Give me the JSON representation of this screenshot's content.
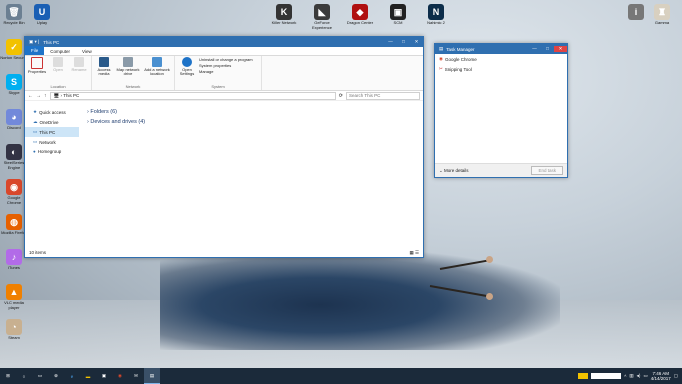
{
  "desktop": {
    "left_icons": [
      {
        "label": "Recycle Bin",
        "color": "#6b7f92",
        "glyph": "🗑"
      },
      {
        "label": "Norton Security",
        "color": "#f2c200",
        "glyph": "✓"
      },
      {
        "label": "Skype",
        "color": "#00aff0",
        "glyph": "S"
      },
      {
        "label": "Discord",
        "color": "#7289da",
        "glyph": "◕"
      },
      {
        "label": "SteelSeries Engine",
        "color": "#334",
        "glyph": "◐"
      },
      {
        "label": "Google Chrome",
        "color": "#d9472b",
        "glyph": "◉"
      },
      {
        "label": "Mozilla Firefox",
        "color": "#e66000",
        "glyph": "◍"
      },
      {
        "label": "iTunes",
        "color": "#b26be8",
        "glyph": "♪"
      },
      {
        "label": "VLC media player",
        "color": "#f08000",
        "glyph": "▲"
      },
      {
        "label": "Steam",
        "color": "#c8b090",
        "glyph": "◔"
      }
    ],
    "second_col_icons": [
      {
        "label": "Uplay",
        "color": "#1a5fb4",
        "glyph": "U"
      }
    ],
    "top_icons": [
      {
        "label": "Killer Network",
        "color": "#333",
        "glyph": "K"
      },
      {
        "label": "GeForce Experience",
        "color": "#3b3b3b",
        "glyph": "◣"
      },
      {
        "label": "Dragon Center",
        "color": "#b01010",
        "glyph": "◆"
      },
      {
        "label": "SCM",
        "color": "#222",
        "glyph": "▣"
      },
      {
        "label": "Nahimic 2",
        "color": "#0c2d4a",
        "glyph": "N"
      }
    ],
    "right_icons": [
      {
        "label": "",
        "color": "#777",
        "glyph": "i"
      },
      {
        "label": "Gamma",
        "color": "#d8d0c0",
        "glyph": "♜"
      }
    ]
  },
  "explorer": {
    "title": "This PC",
    "tabs": [
      "File",
      "Computer",
      "View"
    ],
    "ribbon": {
      "location": {
        "buttons": [
          "Properties",
          "Open",
          "Rename"
        ],
        "label": "Location"
      },
      "network": {
        "buttons": [
          "Access media",
          "Map network drive",
          "Add a network location"
        ],
        "label": "Network"
      },
      "system": {
        "big": "Open Settings",
        "items": [
          "Uninstall or change a program",
          "System properties",
          "Manage"
        ],
        "label": "System"
      }
    },
    "address": "This PC",
    "search_placeholder": "Search This PC",
    "nav": [
      "Quick access",
      "OneDrive",
      "This PC",
      "Network",
      "Homegroup"
    ],
    "sections": [
      "Folders (6)",
      "Devices and drives (4)"
    ],
    "status": "10 items"
  },
  "taskmgr": {
    "title": "Task Manager",
    "apps": [
      "Google Chrome",
      "Snipping Tool"
    ],
    "more_details": "More details",
    "end_task": "End task"
  },
  "taskbar": {
    "time": "7:46 AM",
    "date": "4/14/2017"
  }
}
